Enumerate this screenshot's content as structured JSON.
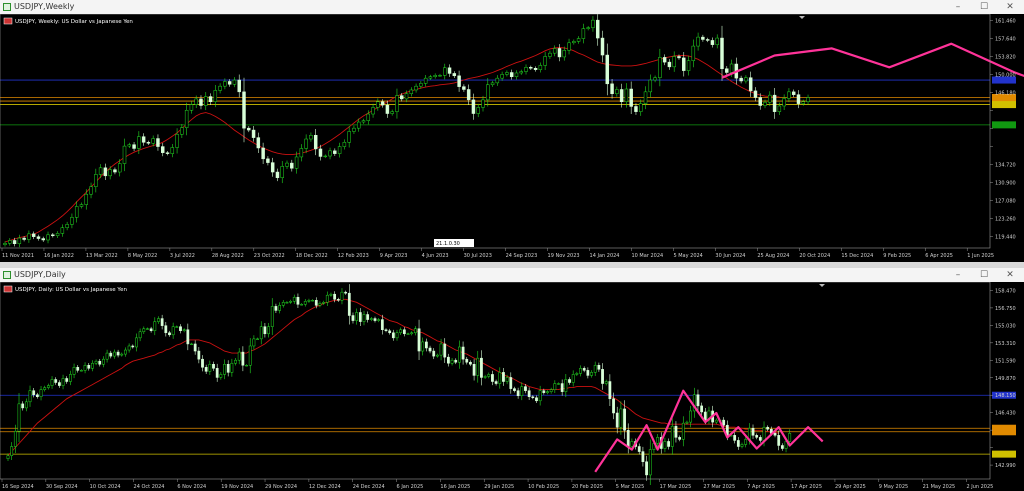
{
  "window1": {
    "title": "USDJPY,Weekly",
    "chart_header": "USDJPY, Weekly: US Dollar vs Japanese Yen"
  },
  "window2": {
    "title": "USDJPY,Daily",
    "chart_header": "USDJPY, Daily: US Dollar vs Japanese Yen"
  },
  "window_buttons": {
    "minimize": "–",
    "maximize": "☐",
    "close": "✕"
  },
  "colors": {
    "bull": "#22dd22",
    "bear": "#d8ffd8",
    "ma": "#cc1111",
    "pattern": "#ff3399",
    "level_blue": "#2233cc",
    "level_orange": "#e08a00",
    "level_yellow": "#d0c000",
    "level_green": "#119911"
  },
  "icons": {
    "chart_icon": "chart-window-icon",
    "symbol_icon": "flag-icon"
  },
  "chart_data": [
    {
      "type": "candlestick",
      "timeframe": "Weekly",
      "price_axis_ticks": [
        161.46,
        157.64,
        153.82,
        150.0,
        146.18,
        142.36,
        138.54,
        134.72,
        130.9,
        127.08,
        123.26,
        119.44,
        115.62
      ],
      "ylim": [
        113.2,
        162.8
      ],
      "price_axis_tick_labels": [
        "161.460",
        "157.640",
        "153.820",
        "150.000",
        "146.180",
        "",
        "",
        "",
        "134.720",
        "130.900",
        "127.080",
        "123.260",
        "119.440",
        "115.620"
      ],
      "time_axis_labels": [
        "11 Nov 2021",
        "16 Jan 2022",
        "13 Mar 2022",
        "8 May 2022",
        "3 Jul 2022",
        "28 Aug 2022",
        "23 Oct 2022",
        "18 Dec 2022",
        "12 Feb 2023",
        "9 Apr 2023",
        "4 Jun 2023",
        "30 Jul 2023",
        "24 Sep 2023",
        "19 Nov 2023",
        "14 Jan 2024",
        "10 Mar 2024",
        "5 May 2024",
        "30 Jun 2024",
        "25 Aug 2024",
        "20 Oct 2024",
        "15 Dec 2024",
        "9 Feb 2025",
        "6 Apr 2025",
        "1 Jun 2025"
      ],
      "crosshair_label": "21.1.0.30",
      "levels": [
        {
          "price": 148.8,
          "label": "",
          "color": "#2233cc"
        },
        {
          "price": 145.1,
          "label": "",
          "color": "#e08a00"
        },
        {
          "price": 144.35,
          "label": "",
          "color": "#e08a00"
        },
        {
          "price": 143.6,
          "label": "",
          "color": "#d0c000"
        },
        {
          "price": 139.3,
          "label": "",
          "color": "#119911"
        }
      ],
      "pattern_points": [
        [
          150.0,
          149.3
        ],
        [
          161.0,
          154.0
        ],
        [
          173.0,
          155.5
        ],
        [
          185.0,
          151.5
        ],
        [
          198.0,
          156.5
        ],
        [
          211.0,
          150.5
        ],
        [
          223.0,
          146.0
        ],
        [
          236.0,
          142.8
        ],
        [
          249.0,
          147.0
        ],
        [
          257.0,
          143.5
        ],
        [
          262.0,
          145.0
        ]
      ],
      "series": [
        {
          "close": [
            114.2,
            114.8,
            114.1,
            115.3,
            115.0,
            116.2,
            115.6,
            115.2,
            114.9,
            116.0,
            115.8,
            116.3,
            117.5,
            118.2,
            119.7,
            122.0,
            122.4,
            124.6,
            126.2,
            128.8,
            130.2,
            128.5,
            129.8,
            129.3,
            131.1,
            134.8,
            135.1,
            134.3,
            136.8,
            135.6,
            135.4,
            136.4,
            134.7,
            133.4,
            133.2,
            134.5,
            137.3,
            138.7,
            142.4,
            143.6,
            144.8,
            143.4,
            145.3,
            144.2,
            146.6,
            147.5,
            148.5,
            147.9,
            148.8,
            146.3,
            138.6,
            138.2,
            136.6,
            134.4,
            132.1,
            131.3,
            129.3,
            128.1,
            130.5,
            131.2,
            130.1,
            132.5,
            134.3,
            136.3,
            137.1,
            134.2,
            132.6,
            132.7,
            133.8,
            133.2,
            134.7,
            135.6,
            137.9,
            138.6,
            139.9,
            140.2,
            141.6,
            143.0,
            144.2,
            143.5,
            141.7,
            142.1,
            145.5,
            144.8,
            145.9,
            146.7,
            147.5,
            148.1,
            149.2,
            149.5,
            149.8,
            149.8,
            151.4,
            150.2,
            149.7,
            147.4,
            146.8,
            144.6,
            141.7,
            143.0,
            144.6,
            147.8,
            148.2,
            149.2,
            150.0,
            150.4,
            149.5,
            150.3,
            150.6,
            151.5,
            151.3,
            151.0,
            151.9,
            153.8,
            154.5,
            155.5,
            153.7,
            155.1,
            156.7,
            157.0,
            157.6,
            159.7,
            159.9,
            161.5,
            157.7,
            154.1,
            148.0,
            145.9,
            146.8,
            144.2,
            146.9,
            143.2,
            142.1,
            143.8,
            146.3,
            148.8,
            149.3,
            153.6,
            152.6,
            151.6,
            153.8,
            153.5,
            150.8,
            152.9,
            156.0,
            157.9,
            157.4,
            157.2,
            156.3,
            157.7,
            151.2,
            150.4,
            152.2,
            149.2,
            148.6,
            149.3,
            146.5,
            145.1,
            143.4,
            144.1,
            145.6,
            142.1,
            143.3,
            144.9,
            146.3,
            145.7,
            143.8,
            144.2,
            145.1
          ]
        }
      ],
      "ma_values": [
        114.5,
        114.8,
        115.1,
        115.4,
        115.6,
        115.9,
        116.1,
        116.6,
        117.2,
        117.8,
        118.5,
        119.2,
        120.0,
        120.9,
        121.9,
        123.0,
        124.0,
        125.0,
        126.1,
        127.2,
        128.3,
        129.3,
        130.2,
        131.0,
        131.7,
        132.4,
        133.0,
        133.5,
        133.9,
        134.3,
        134.6,
        134.9,
        135.2,
        135.6,
        136.2,
        136.9,
        137.6,
        138.5,
        139.5,
        140.4,
        141.2,
        141.7,
        141.9,
        141.6,
        141.1,
        140.5,
        139.8,
        139.0,
        138.2,
        137.5,
        136.8,
        136.1,
        135.5,
        134.9,
        134.4,
        134.0,
        133.6,
        133.3,
        133.1,
        133.0,
        133.0,
        133.1,
        133.3,
        133.6,
        133.9,
        134.3,
        134.7,
        135.3,
        135.9,
        136.6,
        137.3,
        138.1,
        138.9,
        139.7,
        140.5,
        141.2,
        141.8,
        142.4,
        143.0,
        143.6,
        144.2,
        144.8,
        145.4,
        145.8,
        146.2,
        146.5,
        146.8,
        147.1,
        147.3,
        147.5,
        147.6,
        147.8,
        147.9,
        148.0,
        148.2,
        148.5,
        148.8,
        149.1,
        149.3,
        149.5,
        149.8,
        150.1,
        150.4,
        150.8,
        151.2,
        151.7,
        152.1,
        152.5,
        152.8,
        153.2,
        153.6,
        154.0,
        154.5,
        155.0,
        155.4,
        155.6,
        155.7,
        155.6,
        155.4,
        155.0,
        154.5,
        154.1,
        153.6,
        153.1,
        152.6,
        152.3,
        152.1,
        152.0,
        151.9,
        151.8,
        151.8,
        151.8,
        151.9,
        152.1,
        152.3,
        152.6,
        152.9,
        153.2,
        153.5,
        153.7,
        153.9,
        154.0,
        154.0,
        153.9,
        153.6,
        153.2,
        152.6,
        152.0,
        151.3,
        150.6,
        149.9,
        149.2,
        148.5,
        147.9,
        147.3,
        146.8,
        146.3,
        145.9,
        145.6,
        145.4,
        145.3,
        145.2,
        145.2
      ]
    },
    {
      "type": "candlestick",
      "timeframe": "Daily",
      "price_axis_tick_labels": [
        "158.470",
        "156.750",
        "155.030",
        "153.310",
        "151.590",
        "149.870",
        "148.150",
        "146.430",
        "",
        "",
        "142.990",
        "141.270"
      ],
      "price_axis_ticks": [
        158.47,
        156.75,
        155.03,
        153.31,
        151.59,
        149.87,
        148.15,
        146.43,
        144.71,
        142.99,
        141.27
      ],
      "ylim": [
        139.9,
        159.3
      ],
      "time_axis_labels": [
        "16 Sep 2024",
        "30 Sep 2024",
        "10 Oct 2024",
        "24 Oct 2024",
        "6 Nov 2024",
        "19 Nov 2024",
        "29 Nov 2024",
        "12 Dec 2024",
        "24 Dec 2024",
        "6 Jan 2025",
        "16 Jan 2025",
        "29 Jan 2025",
        "10 Feb 2025",
        "20 Feb 2025",
        "5 Mar 2025",
        "17 Mar 2025",
        "27 Mar 2025",
        "7 Apr 2025",
        "17 Apr 2025",
        "29 Apr 2025",
        "9 May 2025",
        "21 May 2025",
        "2 Jun 2025"
      ],
      "levels": [
        {
          "price": 148.15,
          "label": "",
          "color": "#2233cc"
        },
        {
          "price": 144.9,
          "label": "",
          "color": "#e08a00"
        },
        {
          "price": 144.55,
          "label": "",
          "color": "#e08a00"
        },
        {
          "price": 142.35,
          "label": "",
          "color": "#d0c000"
        }
      ],
      "pattern_points": [
        [
          160.0,
          140.6
        ],
        [
          166.0,
          143.8
        ],
        [
          170.0,
          142.8
        ],
        [
          174.0,
          145.2
        ],
        [
          177.0,
          142.8
        ],
        [
          184.0,
          148.6
        ],
        [
          190.0,
          145.5
        ],
        [
          193.0,
          146.4
        ],
        [
          196.0,
          144.0
        ],
        [
          199.0,
          145.0
        ],
        [
          204.0,
          142.9
        ],
        [
          210.0,
          145.0
        ],
        [
          213.0,
          143.2
        ],
        [
          218.0,
          145.0
        ],
        [
          222.0,
          143.6
        ]
      ],
      "series": [
        {
          "close": [
            142.2,
            143.1,
            144.6,
            147.3,
            146.9,
            147.5,
            148.6,
            148.2,
            148.0,
            148.7,
            148.9,
            149.1,
            149.7,
            149.4,
            149.1,
            149.8,
            149.5,
            150.2,
            150.9,
            150.6,
            150.6,
            151.1,
            150.8,
            151.3,
            151.5,
            151.2,
            151.7,
            152.3,
            152.0,
            152.4,
            152.1,
            152.2,
            152.6,
            153.0,
            152.9,
            153.8,
            154.4,
            154.7,
            154.7,
            154.5,
            155.4,
            155.7,
            155.0,
            154.3,
            154.1,
            154.9,
            154.9,
            154.5,
            154.6,
            153.2,
            153.2,
            152.5,
            151.7,
            150.9,
            150.5,
            151.2,
            150.8,
            149.9,
            150.2,
            151.2,
            150.4,
            151.3,
            151.6,
            152.4,
            151.1,
            151.1,
            153.0,
            153.7,
            153.7,
            154.9,
            154.2,
            154.9,
            156.9,
            156.5,
            157.0,
            157.3,
            157.3,
            157.4,
            157.8,
            157.1,
            157.1,
            157.4,
            157.5,
            157.5,
            157.0,
            157.2,
            157.3,
            158.0,
            158.1,
            157.6,
            157.5,
            158.3,
            158.2,
            156.0,
            155.5,
            156.3,
            155.4,
            156.1,
            155.6,
            155.7,
            155.5,
            155.6,
            154.6,
            154.5,
            154.3,
            153.8,
            154.3,
            154.6,
            154.2,
            154.2,
            154.3,
            154.7,
            152.5,
            153.4,
            152.8,
            152.5,
            152.0,
            152.1,
            153.2,
            151.9,
            151.3,
            151.6,
            151.4,
            152.9,
            151.7,
            151.4,
            151.2,
            150.1,
            151.8,
            149.9,
            150.0,
            150.2,
            149.5,
            149.3,
            150.4,
            149.5,
            149.9,
            148.8,
            148.6,
            148.1,
            149.0,
            148.6,
            148.0,
            147.9,
            147.6,
            148.6,
            148.4,
            148.5,
            148.7,
            149.3,
            149.3,
            148.5,
            149.7,
            149.4,
            150.2,
            150.3,
            150.8,
            150.6,
            150.1,
            150.4,
            151.1,
            150.7,
            149.3,
            149.5,
            147.8,
            146.4,
            145.0,
            146.8,
            144.7,
            143.1,
            143.6,
            143.1,
            142.6,
            141.6,
            140.3,
            142.8,
            143.4,
            144.0,
            142.9,
            143.6,
            143.1,
            145.1,
            144.0,
            143.8,
            145.4,
            145.5,
            146.6,
            148.2,
            147.1,
            146.5,
            145.7,
            146.6,
            145.5,
            145.7,
            145.7,
            145.2,
            144.2,
            144.2,
            143.7,
            143.1,
            143.3,
            143.8,
            144.9,
            144.2,
            144.0,
            143.7,
            145.0,
            144.8,
            144.4,
            144.2,
            143.2,
            142.9,
            143.6,
            144.4
          ]
        }
      ],
      "ma_values": [
        142.2,
        142.6,
        143.0,
        143.4,
        143.8,
        144.2,
        144.6,
        145.0,
        145.4,
        145.7,
        146.0,
        146.3,
        146.6,
        146.9,
        147.2,
        147.5,
        147.8,
        148.0,
        148.2,
        148.4,
        148.6,
        148.8,
        149.0,
        149.2,
        149.4,
        149.6,
        149.8,
        150.0,
        150.2,
        150.4,
        150.6,
        150.8,
        151.1,
        151.3,
        151.5,
        151.6,
        151.7,
        151.8,
        151.9,
        152.0,
        152.1,
        152.3,
        152.4,
        152.6,
        152.7,
        152.9,
        153.1,
        153.2,
        153.4,
        153.6,
        153.6,
        153.6,
        153.6,
        153.5,
        153.4,
        153.3,
        153.1,
        152.9,
        152.7,
        152.5,
        152.4,
        152.3,
        152.3,
        152.3,
        152.3,
        152.3,
        152.5,
        152.6,
        152.8,
        153.0,
        153.2,
        153.5,
        153.8,
        154.1,
        154.4,
        154.7,
        155.0,
        155.3,
        155.6,
        155.8,
        156.0,
        156.3,
        156.5,
        156.7,
        156.9,
        157.0,
        157.2,
        157.3,
        157.4,
        157.5,
        157.5,
        157.6,
        157.6,
        157.5,
        157.4,
        157.3,
        157.1,
        156.9,
        156.7,
        156.5,
        156.3,
        156.1,
        155.9,
        155.7,
        155.5,
        155.4,
        155.3,
        155.1,
        154.9,
        154.8,
        154.6,
        154.5,
        154.4,
        154.3,
        154.1,
        153.9,
        153.7,
        153.5,
        153.4,
        153.2,
        153.0,
        152.8,
        152.6,
        152.5,
        152.3,
        152.2,
        152.0,
        151.8,
        151.6,
        151.4,
        151.2,
        151.0,
        150.8,
        150.6,
        150.4,
        150.2,
        150.0,
        149.9,
        149.7,
        149.5,
        149.3,
        149.2,
        149.0,
        148.9,
        148.8,
        148.7,
        148.7,
        148.7,
        148.7,
        148.7,
        148.7,
        148.8,
        148.8,
        148.9,
        148.9,
        149.0,
        149.0,
        149.0,
        149.0,
        149.0,
        148.9,
        148.7,
        148.5,
        148.3,
        148.1,
        147.9,
        147.7,
        147.4,
        147.1,
        146.9,
        146.6,
        146.3,
        146.1,
        145.9,
        145.8,
        145.7,
        145.6,
        145.5,
        145.4,
        145.4,
        145.3,
        145.3,
        145.3,
        145.3,
        145.3,
        145.3,
        145.3,
        145.3,
        145.3,
        145.3,
        145.3,
        145.3,
        145.3,
        145.3,
        145.2,
        145.1,
        145.0,
        145.0,
        145.0,
        144.9,
        144.9,
        144.8,
        144.8,
        144.7,
        144.7,
        144.7,
        144.6,
        144.6,
        144.5,
        144.5,
        144.4
      ]
    }
  ]
}
